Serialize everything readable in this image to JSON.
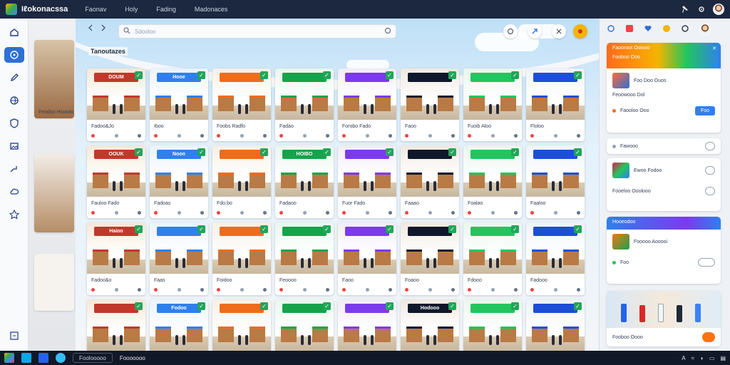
{
  "app": {
    "title": "Iℓokonacssa"
  },
  "menu": [
    "Faonav",
    "Holy",
    "Fading",
    "Madonaces"
  ],
  "search": {
    "placeholder": "Sdooloo"
  },
  "section": {
    "title": "Tanoutazes"
  },
  "tiles": [
    {
      "label": "Fadoo&Jo"
    },
    {
      "label": "Iboo"
    },
    {
      "label": "Foobs Radfo"
    },
    {
      "label": "Fadao"
    },
    {
      "label": "Forobo Fado"
    },
    {
      "label": "Faoo"
    },
    {
      "label": "Fuoib Aloo"
    },
    {
      "label": "Floloo"
    },
    {
      "label": "Fauloo Fado"
    },
    {
      "label": "Fadoas"
    },
    {
      "label": "Fdo.bo"
    },
    {
      "label": "Fadaoo"
    },
    {
      "label": "Fuor Fado"
    },
    {
      "label": "Faaao"
    },
    {
      "label": "Foalao"
    },
    {
      "label": "Faaloo"
    },
    {
      "label": "Fadoo&o"
    },
    {
      "label": "Faas"
    },
    {
      "label": "Foidoo"
    },
    {
      "label": "Feoooo"
    },
    {
      "label": "Faoo"
    },
    {
      "label": "Foaoo"
    },
    {
      "label": "Fdooo"
    },
    {
      "label": "Fadooo"
    },
    {
      "label": ""
    },
    {
      "label": ""
    },
    {
      "label": ""
    },
    {
      "label": ""
    },
    {
      "label": ""
    },
    {
      "label": ""
    },
    {
      "label": ""
    },
    {
      "label": ""
    }
  ],
  "signs": [
    "DOUM",
    "Hooe",
    "",
    "",
    "",
    "",
    "",
    "",
    "OOUK",
    "Noon",
    "",
    "HOIBO",
    "",
    "",
    "",
    "",
    "Haioo",
    "",
    "",
    "",
    "",
    "",
    "",
    "",
    "",
    "Fodoo",
    "",
    "",
    "",
    "Hodooo",
    "",
    ""
  ],
  "peek": {
    "label": "Feodoo Hiooolo"
  },
  "right_panel": {
    "card1": {
      "head": "Faooroot Ooiooo",
      "sub": "Fooboo Ooo",
      "item": "Foo Doo Ouos",
      "meta": "Feoowooo Dol",
      "footer": "Faooloo Ooo",
      "action": "Foo"
    },
    "row1": "Fawooo",
    "card2": {
      "title": "Ewoo Fodoo",
      "meta": "Fooeloo Ooolooo"
    },
    "card3": {
      "head": "Hooeodoo",
      "item": "Fooooo Aooooi",
      "meta": "Foo"
    },
    "card4": {
      "caption": "Fooboo Oooo"
    }
  },
  "taskbar": {
    "search": "Foolooooo",
    "app": "Fooooooo"
  },
  "colors": {
    "accent": "#2f6fd6",
    "topbar": "#1c2740"
  }
}
